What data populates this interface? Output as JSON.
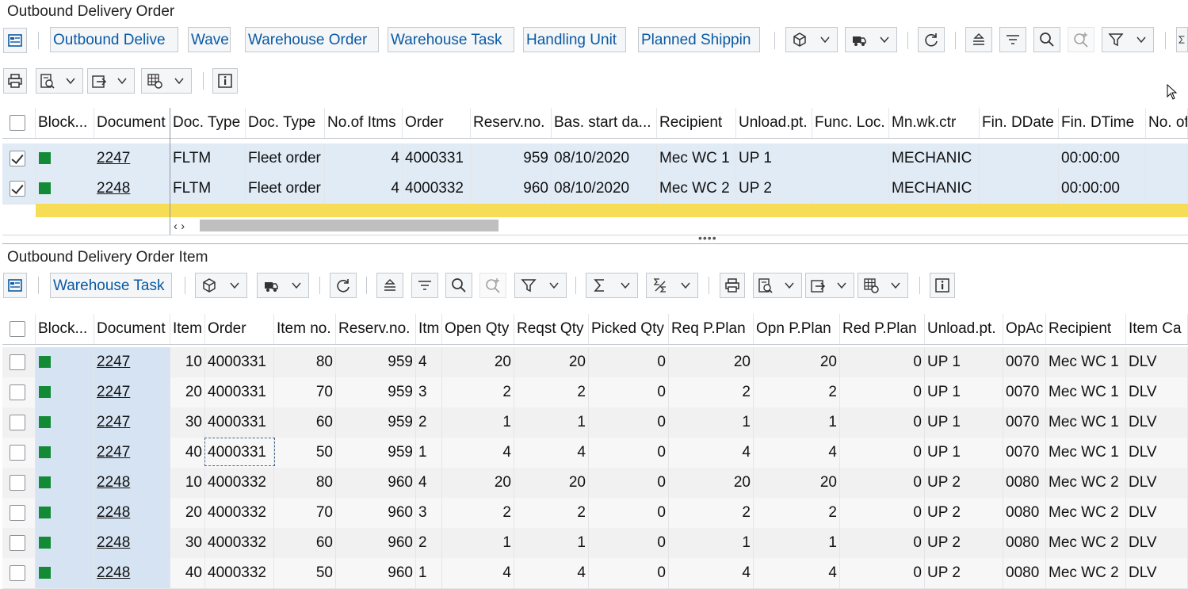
{
  "top": {
    "title": "Outbound Delivery Order",
    "buttons": [
      "Outbound Delive",
      "Wave",
      "Warehouse Order",
      "Warehouse Task",
      "Handling Unit",
      "Planned Shippin"
    ],
    "columns": [
      "Block...",
      "Document",
      "Doc. Type",
      "Doc. Type",
      "No.of Itms",
      "Order",
      "Reserv.no.",
      "Bas. start da...",
      "Recipient",
      "Unload.pt.",
      "Func. Loc.",
      "Mn.wk.ctr",
      "Fin. DDate",
      "Fin. DTime",
      "No. of"
    ],
    "rows": [
      {
        "doc": "2247",
        "doctype": "FLTM",
        "doctype_desc": "Fleet order",
        "items": "4",
        "order": "4000331",
        "reserv": "959",
        "start": "08/10/2020",
        "recipient": "Mec WC 1",
        "unload": "UP 1",
        "func": "",
        "wkctr": "MECHANIC",
        "fdate": "",
        "ftime": "00:00:00"
      },
      {
        "doc": "2248",
        "doctype": "FLTM",
        "doctype_desc": "Fleet order",
        "items": "4",
        "order": "4000332",
        "reserv": "960",
        "start": "08/10/2020",
        "recipient": "Mec WC 2",
        "unload": "UP 2",
        "func": "",
        "wkctr": "MECHANIC",
        "fdate": "",
        "ftime": "00:00:00"
      }
    ]
  },
  "bottom": {
    "title": "Outbound Delivery Order Item",
    "buttons": [
      "Warehouse Task"
    ],
    "columns": [
      "Block...",
      "Document",
      "Item",
      "Order",
      "Item no.",
      "Reserv.no.",
      "Itm",
      "Open Qty",
      "Reqst Qty",
      "Picked Qty",
      "Req P.Plan",
      "Opn P.Plan",
      "Red P.Plan",
      "Unload.pt.",
      "OpAc",
      "Recipient",
      "Item Ca"
    ],
    "rows": [
      {
        "doc": "2247",
        "item": "10",
        "order": "4000331",
        "itemno": "80",
        "reserv": "959",
        "itm": "4",
        "open": "20",
        "reqst": "20",
        "picked": "0",
        "req": "20",
        "opn": "20",
        "red": "0",
        "unload": "UP 1",
        "opac": "0070",
        "recipient": "Mec WC 1",
        "cat": "DLV"
      },
      {
        "doc": "2247",
        "item": "20",
        "order": "4000331",
        "itemno": "70",
        "reserv": "959",
        "itm": "3",
        "open": "2",
        "reqst": "2",
        "picked": "0",
        "req": "2",
        "opn": "2",
        "red": "0",
        "unload": "UP 1",
        "opac": "0070",
        "recipient": "Mec WC 1",
        "cat": "DLV"
      },
      {
        "doc": "2247",
        "item": "30",
        "order": "4000331",
        "itemno": "60",
        "reserv": "959",
        "itm": "2",
        "open": "1",
        "reqst": "1",
        "picked": "0",
        "req": "1",
        "opn": "1",
        "red": "0",
        "unload": "UP 1",
        "opac": "0070",
        "recipient": "Mec WC 1",
        "cat": "DLV"
      },
      {
        "doc": "2247",
        "item": "40",
        "order": "4000331",
        "itemno": "50",
        "reserv": "959",
        "itm": "1",
        "open": "4",
        "reqst": "4",
        "picked": "0",
        "req": "4",
        "opn": "4",
        "red": "0",
        "unload": "UP 1",
        "opac": "0070",
        "recipient": "Mec WC 1",
        "cat": "DLV"
      },
      {
        "doc": "2248",
        "item": "10",
        "order": "4000332",
        "itemno": "80",
        "reserv": "960",
        "itm": "4",
        "open": "20",
        "reqst": "20",
        "picked": "0",
        "req": "20",
        "opn": "20",
        "red": "0",
        "unload": "UP 2",
        "opac": "0080",
        "recipient": "Mec WC 2",
        "cat": "DLV"
      },
      {
        "doc": "2248",
        "item": "20",
        "order": "4000332",
        "itemno": "70",
        "reserv": "960",
        "itm": "3",
        "open": "2",
        "reqst": "2",
        "picked": "0",
        "req": "2",
        "opn": "2",
        "red": "0",
        "unload": "UP 2",
        "opac": "0080",
        "recipient": "Mec WC 2",
        "cat": "DLV"
      },
      {
        "doc": "2248",
        "item": "30",
        "order": "4000332",
        "itemno": "60",
        "reserv": "960",
        "itm": "2",
        "open": "1",
        "reqst": "1",
        "picked": "0",
        "req": "1",
        "opn": "1",
        "red": "0",
        "unload": "UP 2",
        "opac": "0080",
        "recipient": "Mec WC 2",
        "cat": "DLV"
      },
      {
        "doc": "2248",
        "item": "40",
        "order": "4000332",
        "itemno": "50",
        "reserv": "960",
        "itm": "1",
        "open": "4",
        "reqst": "4",
        "picked": "0",
        "req": "4",
        "opn": "4",
        "red": "0",
        "unload": "UP 2",
        "opac": "0080",
        "recipient": "Mec WC 2",
        "cat": "DLV"
      }
    ]
  },
  "colors": {
    "status_green": "#138a36",
    "selected_row": "#e1ebf6",
    "highlight": "#f7dd55",
    "link_blue": "#0a5aa5"
  }
}
